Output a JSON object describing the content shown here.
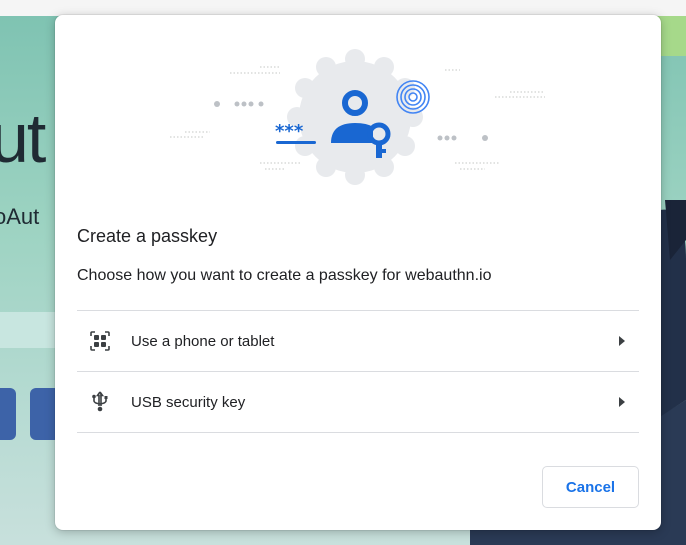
{
  "background": {
    "hero_text": "ut",
    "sub_text": "oAut"
  },
  "dialog": {
    "title": "Create a passkey",
    "subtitle": "Choose how you want to create a passkey for webauthn.io",
    "options": [
      {
        "label": "Use a phone or tablet",
        "icon": "qr-code-icon"
      },
      {
        "label": "USB security key",
        "icon": "usb-icon"
      }
    ],
    "cancel_label": "Cancel"
  },
  "colors": {
    "accent": "#1a73e8",
    "illustration_blue": "#1967d2",
    "badge_gray": "#e8eaed"
  }
}
